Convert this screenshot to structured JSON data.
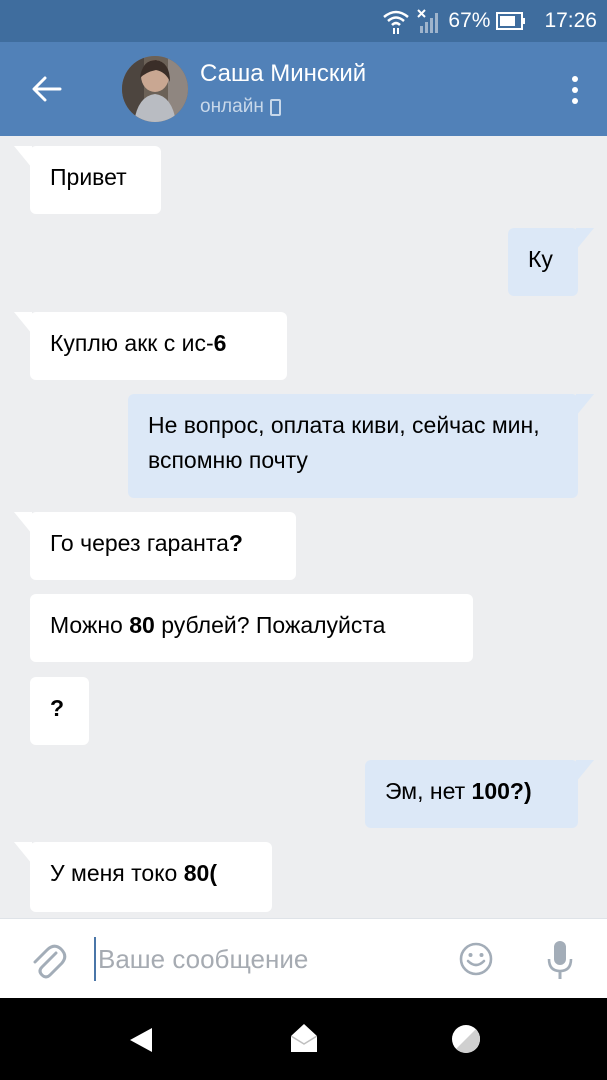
{
  "status_bar": {
    "battery": "67%",
    "time": "17:26",
    "icons": [
      "wifi-icon",
      "signal-icon",
      "battery-icon"
    ]
  },
  "header": {
    "contact_name": "Саша Минский",
    "contact_status": "онлайн",
    "icons": [
      "back-arrow-icon",
      "phone-icon",
      "more-vert-icon"
    ]
  },
  "messages": [
    {
      "direction": "in",
      "text": "Привет"
    },
    {
      "direction": "out",
      "text": "Ку"
    },
    {
      "direction": "in",
      "text": "Куплю акк с ис-6"
    },
    {
      "direction": "out",
      "text": "Не вопрос, оплата киви, сейчас мин, вспомню почту"
    },
    {
      "direction": "in",
      "text": "Го через гаранта?"
    },
    {
      "direction": "in",
      "text": "Можно 80 рублей? Пожалуйста"
    },
    {
      "direction": "in",
      "text": "?"
    },
    {
      "direction": "out",
      "text": "Эм, нет 100?)"
    },
    {
      "direction": "in",
      "text": "У меня токо 80("
    }
  ],
  "composer": {
    "placeholder": "Ваше сообщение",
    "icons": [
      "paperclip-icon",
      "smiley-icon",
      "microphone-icon"
    ]
  },
  "navigation": {
    "icons": [
      "nav-back-icon",
      "nav-home-icon",
      "nav-recent-icon"
    ]
  },
  "colors": {
    "status_bar": "#3f6d9e",
    "header": "#5181b8",
    "background": "#edeef0",
    "bubble_in": "#ffffff",
    "bubble_out": "#dce8f7"
  }
}
